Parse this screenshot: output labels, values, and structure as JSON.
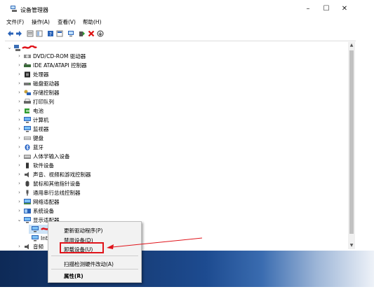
{
  "window": {
    "title": "设备管理器",
    "controls": [
      "–",
      "☐",
      "✕"
    ]
  },
  "menu": [
    "文件(F)",
    "操作(A)",
    "查看(V)",
    "帮助(H)"
  ],
  "tree": {
    "root": "·",
    "items": [
      "DVD/CD-ROM 驱动器",
      "IDE ATA/ATAPI 控制器",
      "处理器",
      "磁盘驱动器",
      "存储控制器",
      "打印队列",
      "电池",
      "计算机",
      "监视器",
      "键盘",
      "蓝牙",
      "人体学输入设备",
      "软件设备",
      "声音、视频和游戏控制器",
      "鼠标和其他指针设备",
      "通用串行总线控制器",
      "网络适配器",
      "系统设备",
      "显示适配器"
    ],
    "sub_items": [
      "·",
      "Int"
    ],
    "last_item": "音频"
  },
  "context_menu": {
    "items": [
      "更新驱动程序(P)",
      "禁用设备(D)",
      "卸载设备(U)",
      "扫描检测硬件改动(A)",
      "属性(R)"
    ]
  },
  "colors": {
    "highlight": "#e0141b",
    "taskbar": "#173d78"
  }
}
